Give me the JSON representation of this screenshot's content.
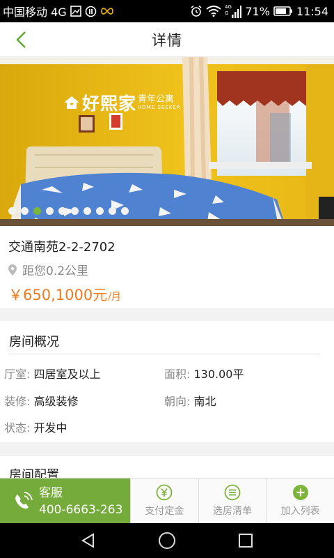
{
  "status_bar": {
    "carrier": "中国移动 4G",
    "battery": "71%",
    "time": "11:54",
    "icons": [
      "image-icon",
      "pause-icon",
      "infinity-icon",
      "alarm-icon",
      "wifi-icon",
      "signal-4g-icon",
      "battery-icon"
    ]
  },
  "navbar": {
    "title": "详情",
    "back_icon": "back-chevron-icon"
  },
  "hero": {
    "brand_name": "好熙家",
    "brand_sub": "青年公寓",
    "brand_en": "HOME SEEKER",
    "dot_count": 10,
    "active_dot": 2,
    "colors": {
      "wall": "#e0b40e",
      "bedspread": "#4f83d1",
      "active_dot": "#7db53a"
    }
  },
  "info": {
    "name": "交通南苑2-2-2702",
    "distance": "距您0.2公里",
    "price": "￥650,1000元",
    "price_unit": "/月",
    "price_color": "#f07a1e"
  },
  "overview": {
    "title": "房间概况",
    "attrs": {
      "rooms_key": "厅室:",
      "rooms_val": "四居室及以上",
      "area_key": "面积:",
      "area_val": "130.00平",
      "decor_key": "装修:",
      "decor_val": "高级装修",
      "orient_key": "朝向:",
      "orient_val": "南北",
      "status_key": "状态:",
      "status_val": "开发中"
    }
  },
  "config": {
    "title": "房间配置"
  },
  "bottom_bar": {
    "service_label": "客服",
    "service_phone": "400-6663-263",
    "service_color": "#75ab3a",
    "pay_label": "支付定金",
    "list_label": "选房清单",
    "add_label": "加入列表",
    "add_color": "#7db53a"
  },
  "system_nav": {
    "icons": [
      "back-triangle-icon",
      "home-circle-icon",
      "recents-square-icon"
    ]
  }
}
